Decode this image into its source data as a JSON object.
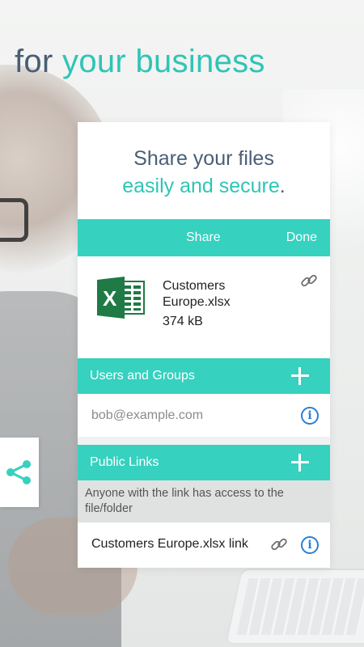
{
  "promo": {
    "headline_part1": "for",
    "headline_part2": "your business",
    "tagline_line1": "Share your files",
    "tagline_line2": "easily and secure",
    "tagline_punct": "."
  },
  "nav": {
    "title": "Share",
    "done_label": "Done"
  },
  "file": {
    "icon": "excel-icon",
    "name": "Customers Europe.xlsx",
    "size": "374 kB"
  },
  "users_section": {
    "label": "Users and Groups",
    "input_placeholder": "bob@example.com"
  },
  "public_links": {
    "label": "Public Links",
    "note": "Anyone with the link has access to the file/folder",
    "link_name": "Customers Europe.xlsx link"
  },
  "colors": {
    "accent": "#36d1bf",
    "heading_dark": "#4a5e75",
    "heading_teal": "#2ec5b6",
    "info_blue": "#2b7fd4",
    "excel_green": "#1f7a45"
  }
}
